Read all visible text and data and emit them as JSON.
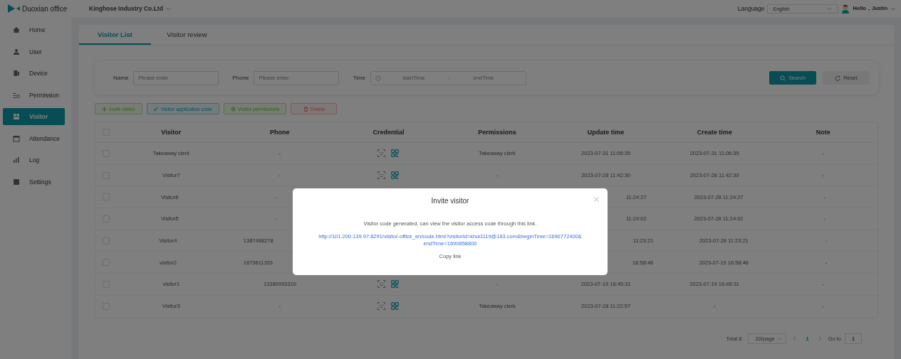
{
  "header": {
    "app_name": "Duoxian office",
    "company": "Kinghose Industry Co.Ltd",
    "language_label": "Language",
    "language_value": "English",
    "greeting": "Hello，Justin"
  },
  "sidebar": {
    "items": [
      {
        "label": "Home",
        "selected": false
      },
      {
        "label": "User",
        "selected": false
      },
      {
        "label": "Device",
        "selected": false
      },
      {
        "label": "Permission",
        "selected": false
      },
      {
        "label": "Visitor",
        "selected": true
      },
      {
        "label": "Attendance",
        "selected": false
      },
      {
        "label": "Log",
        "selected": false
      },
      {
        "label": "Settings",
        "selected": false
      }
    ]
  },
  "tabs": [
    {
      "label": "Visitor List",
      "selected": true
    },
    {
      "label": "Visitor review",
      "selected": false
    }
  ],
  "filters": {
    "name_label": "Name",
    "name_placeholder": "Please enter",
    "phone_label": "Phone",
    "phone_placeholder": "Please enter",
    "time_label": "Time",
    "start_placeholder": "startTime",
    "separator": "-",
    "end_placeholder": "endTime",
    "search": "Search",
    "reset": "Reset"
  },
  "actions": [
    {
      "label": "Invite visitor",
      "kind": "add"
    },
    {
      "label": "Visitor application code",
      "kind": "code"
    },
    {
      "label": "Visitor permissions",
      "kind": "permission"
    },
    {
      "label": "Delete",
      "kind": "delete"
    }
  ],
  "table": {
    "header_checked": false,
    "columns": [
      "Visitor",
      "Phone",
      "Credential",
      "Permissions",
      "Update time",
      "Create time",
      "Note"
    ],
    "rows": [
      {
        "checked": false,
        "visitor": "Takeaway clerk",
        "phone": "-",
        "credential_icons": true,
        "permissions": "Takeaway clerk",
        "update_time": "2023-07-31 11:06:35",
        "create_time": "2023-07-31 11:06:35",
        "note": "-"
      },
      {
        "checked": false,
        "visitor": "Visitor7",
        "phone": "-",
        "credential_icons": true,
        "permissions": "-",
        "update_time": "2023-07-28 11:42:30",
        "create_time": "2023-07-28 11:42:30",
        "note": "-"
      },
      {
        "checked": false,
        "visitor": "Visitor6",
        "phone": "-",
        "update_time_cut": "11:24:27",
        "create_time": "2023-07-28 11:24:27",
        "note": "-"
      },
      {
        "checked": false,
        "visitor": "Visitor5",
        "phone": "-",
        "update_time_cut": "11:24:02",
        "create_time": "2023-07-28 11:24:02",
        "note": "-"
      },
      {
        "checked": false,
        "visitor": "Visitor4",
        "phone_cut": "1387488278",
        "update_time_cut": "11:23:21",
        "create_time": "2023-07-28 11:23:21",
        "note": "-"
      },
      {
        "checked": false,
        "visitor": "visitor2",
        "phone_cut": "1873611353",
        "update_time_cut": "16:58:46",
        "create_time": "2023-07-19 16:58:46",
        "note": "-"
      },
      {
        "checked": false,
        "visitor": "visitor1",
        "phone": "13380993320",
        "credential_icons": true,
        "permissions": "-",
        "update_time": "2023-07-19 16:45:31",
        "create_time": "2023-07-19 16:45:31",
        "note": "-"
      },
      {
        "checked": false,
        "visitor": "Visitor3",
        "phone": "-",
        "credential_icons": true,
        "permissions": "Takeaway clerk",
        "update_time": "2023-07-28 11:22:57",
        "create_time": "-",
        "note": "-"
      }
    ]
  },
  "pagination": {
    "total": "Total 8",
    "page_size": "20/page",
    "pages": [
      {
        "label": "1",
        "selected": true
      }
    ],
    "goto_label": "Go to",
    "goto_value": "1"
  },
  "modal": {
    "title": "Invite visitor",
    "message": "Visitor code generated, can view the visitor access code through this link.",
    "link": "http://101.200.139.97:8291/visitor-office_en/code.html?visitorId=khui1119@163.com&beginTime=1690772400&endTime=1690858800",
    "copy": "Copy link"
  }
}
